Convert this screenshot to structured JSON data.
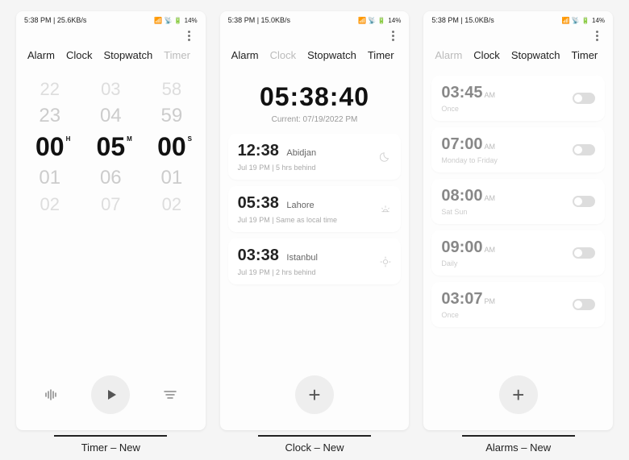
{
  "status": [
    {
      "time_net": "5:38 PM | 25.6KB/s",
      "batt": "14%"
    },
    {
      "time_net": "5:38 PM | 15.0KB/s",
      "batt": "14%"
    },
    {
      "time_net": "5:38 PM | 15.0KB/s",
      "batt": "14%"
    }
  ],
  "tabs": {
    "alarm": "Alarm",
    "clock": "Clock",
    "stopwatch": "Stopwatch",
    "timer": "Timer"
  },
  "timer": {
    "h": {
      "minus2": "22",
      "minus1": "23",
      "sel": "00",
      "plus1": "01",
      "plus2": "02",
      "unit": "H"
    },
    "m": {
      "minus2": "03",
      "minus1": "04",
      "sel": "05",
      "plus1": "06",
      "plus2": "07",
      "unit": "M"
    },
    "s": {
      "minus2": "58",
      "minus1": "59",
      "sel": "00",
      "plus1": "01",
      "plus2": "02",
      "unit": "S"
    }
  },
  "clock": {
    "now": "05:38:40",
    "date": "Current: 07/19/2022 PM",
    "cities": [
      {
        "time": "12:38",
        "name": "Abidjan",
        "sub": "Jul 19 PM  |  5 hrs behind",
        "icon": "moon"
      },
      {
        "time": "05:38",
        "name": "Lahore",
        "sub": "Jul 19 PM  |  Same as local time",
        "icon": "sunset"
      },
      {
        "time": "03:38",
        "name": "Istanbul",
        "sub": "Jul 19 PM  |  2 hrs behind",
        "icon": "sun"
      }
    ]
  },
  "alarms": [
    {
      "time": "03:45",
      "ampm": "AM",
      "sub": "Once"
    },
    {
      "time": "07:00",
      "ampm": "AM",
      "sub": "Monday to Friday"
    },
    {
      "time": "08:00",
      "ampm": "AM",
      "sub": "Sat Sun"
    },
    {
      "time": "09:00",
      "ampm": "AM",
      "sub": "Daily"
    },
    {
      "time": "03:07",
      "ampm": "PM",
      "sub": "Once"
    }
  ],
  "captions": {
    "a": "Timer – New",
    "b": "Clock – New",
    "c": "Alarms – New"
  }
}
